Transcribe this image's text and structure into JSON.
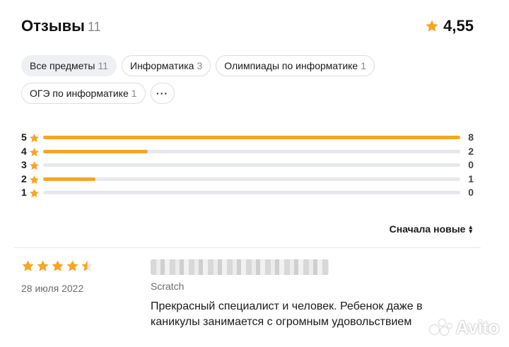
{
  "header": {
    "title": "Отзывы",
    "count": "11",
    "rating": "4,55"
  },
  "filters": {
    "rows": [
      [
        {
          "label": "Все предметы",
          "count": "11",
          "active": true
        },
        {
          "label": "Информатика",
          "count": "3",
          "active": false
        },
        {
          "label": "Олимпиады по информатике",
          "count": "1",
          "active": false
        }
      ],
      [
        {
          "label": "ОГЭ по информатике",
          "count": "1",
          "active": false
        }
      ]
    ],
    "more_label": "···"
  },
  "distribution": [
    {
      "stars": "5",
      "count": "8",
      "fraction": 1.0
    },
    {
      "stars": "4",
      "count": "2",
      "fraction": 0.25
    },
    {
      "stars": "3",
      "count": "0",
      "fraction": 0.0
    },
    {
      "stars": "2",
      "count": "1",
      "fraction": 0.125
    },
    {
      "stars": "1",
      "count": "0",
      "fraction": 0.0
    }
  ],
  "sort": {
    "label": "Сначала новые",
    "icon": "sort-arrows-icon"
  },
  "review": {
    "rating": 4.5,
    "date": "28 июля 2022",
    "subject": "Scratch",
    "text": "Прекрасный специалист и человек. Ребенок даже в каникулы занимается с огромным удовольствием"
  },
  "watermark": {
    "text": "Avito"
  },
  "colors": {
    "star": "#f5a623",
    "track": "#e6e8ec",
    "chip_active_bg": "#eef0f3",
    "muted": "#8a8a8a"
  }
}
